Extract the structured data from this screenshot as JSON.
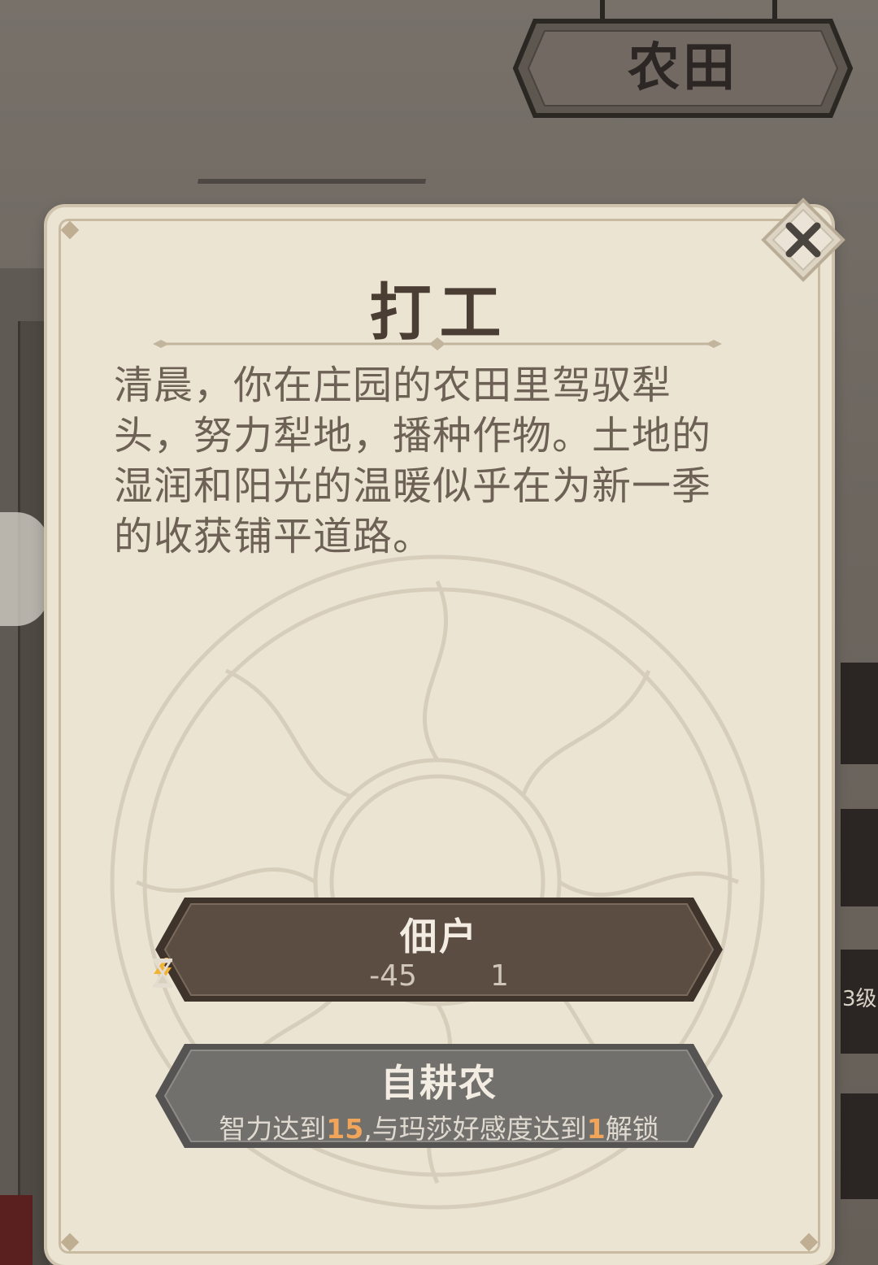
{
  "location": {
    "name": "农田"
  },
  "dialog": {
    "title": "打工",
    "description": "清晨，你在庄园的农田里驾驭犁头，努力犁地，播种作物。土地的湿润和阳光的温暖似乎在为新一季的收获铺平道路。",
    "close_icon": "close-icon"
  },
  "options": {
    "tenant": {
      "label": "佃户",
      "energy_icon": "lightning-icon",
      "energy_cost": "-45",
      "time_icon": "hourglass-icon",
      "time_cost": "1",
      "enabled": true
    },
    "self_farmer": {
      "label": "自耕农",
      "enabled": false,
      "req_prefix": "智力达到",
      "req_intellect": "15",
      "req_middle": ",与玛莎好感度达到",
      "req_affection": "1",
      "req_suffix": "解锁"
    }
  },
  "side_tabs": {
    "level_label": "3级"
  },
  "colors": {
    "parchment": "#ece4d3",
    "button_enabled": "#5c4d42",
    "button_disabled": "#6f6e6b",
    "highlight": "#f0a55a",
    "title_text": "#4a3d33"
  }
}
